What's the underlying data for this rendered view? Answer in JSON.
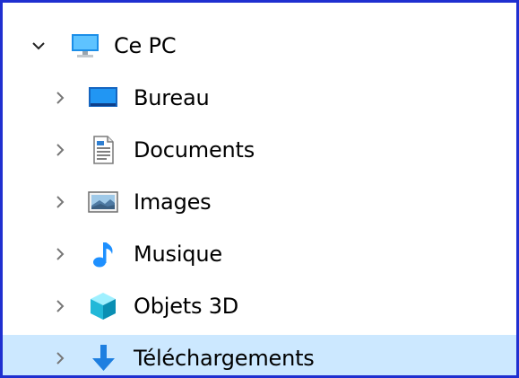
{
  "tree": {
    "root": {
      "label": "Ce PC",
      "expanded": true,
      "icon": "computer-icon"
    },
    "items": [
      {
        "label": "Bureau",
        "icon": "desktop-icon"
      },
      {
        "label": "Documents",
        "icon": "documents-icon"
      },
      {
        "label": "Images",
        "icon": "images-icon"
      },
      {
        "label": "Musique",
        "icon": "music-icon"
      },
      {
        "label": "Objets 3D",
        "icon": "objects-3d-icon"
      },
      {
        "label": "Téléchargements",
        "icon": "downloads-icon",
        "selected": true
      }
    ]
  },
  "colors": {
    "border": "#1f2fd0",
    "selection": "#cce8ff",
    "chevron": "#666666",
    "accent": "#1e90ff"
  }
}
